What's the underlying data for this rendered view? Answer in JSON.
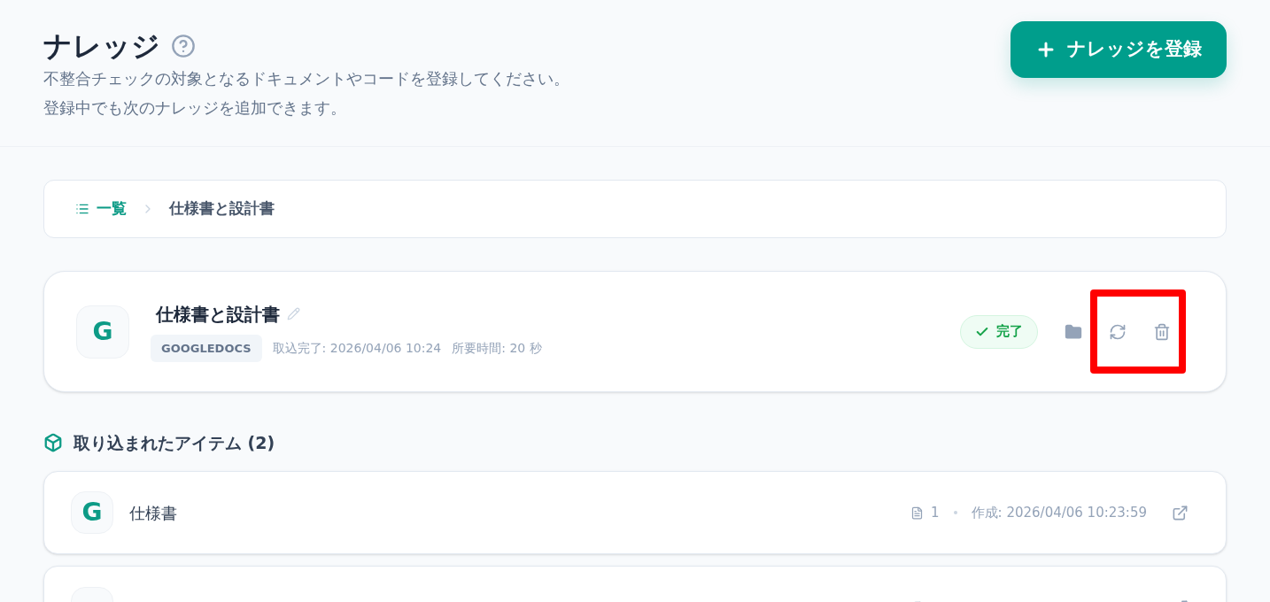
{
  "header": {
    "title": "ナレッジ",
    "description": [
      "不整合チェックの対象となるドキュメントやコードを登録してください。",
      "登録中でも次のナレッジを追加できます。"
    ],
    "register_button": "ナレッジを登録"
  },
  "breadcrumb": [
    {
      "label": "一覧",
      "kind": "link"
    },
    {
      "label": "仕様書と設計書",
      "kind": "current"
    }
  ],
  "knowledge": {
    "icon_letter": "G",
    "title": "仕様書と設計書",
    "source": "GOOGLEDOCS",
    "imported": "取込完了: 2026/04/06 10:24",
    "duration": "所要時間: 20 秒",
    "status": {
      "label": "完了",
      "kind": "done"
    },
    "highlight": true
  },
  "items_section": {
    "title": "取り込まれたアイテム (2)"
  },
  "items": [
    {
      "icon_letter": "G",
      "name": "仕様書",
      "pages": "1",
      "created": "作成: 2026/04/06 10:23:59"
    }
  ],
  "more_items_below": true
}
